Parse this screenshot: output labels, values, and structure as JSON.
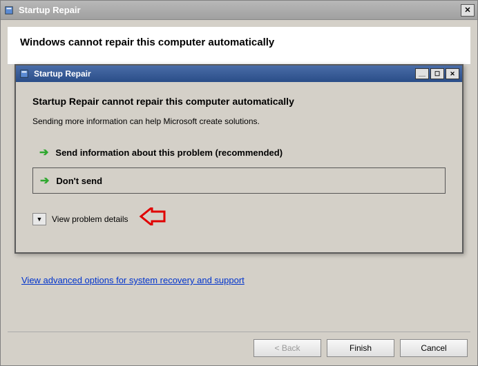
{
  "outer": {
    "title": "Startup Repair",
    "heading": "Windows cannot repair this computer automatically",
    "advanced_link": "View advanced options for system recovery and support",
    "buttons": {
      "back": "< Back",
      "finish": "Finish",
      "cancel": "Cancel"
    }
  },
  "inner": {
    "title": "Startup Repair",
    "heading": "Startup Repair cannot repair this computer automatically",
    "subtext": "Sending more information can help Microsoft create solutions.",
    "option_send": "Send information about this problem (recommended)",
    "option_dont": "Don't send",
    "view_details": "View problem details"
  }
}
